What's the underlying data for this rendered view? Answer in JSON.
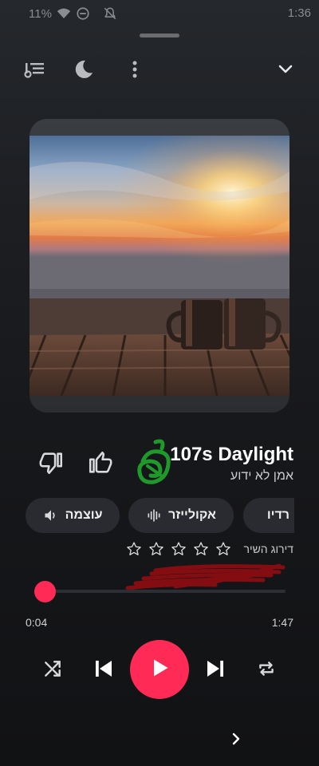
{
  "status_bar": {
    "battery": "11%",
    "time": "1:36",
    "icons": [
      "battery-icon",
      "wifi-icon",
      "do-not-disturb-icon",
      "notifications-off-icon"
    ]
  },
  "toolbar": {
    "icons": [
      "queue-icon",
      "sleep-timer-icon",
      "more-vert-icon",
      "collapse-icon"
    ]
  },
  "track": {
    "title": "107s Daylight",
    "artist": "אמן לא ידוע"
  },
  "chips": {
    "volume_label": "עוצמה",
    "equalizer_label": "אקולייזר",
    "radio_label": "רדיו"
  },
  "rating": {
    "label": "דירוג השיר",
    "stars_total": 5,
    "stars_filled": 0
  },
  "progress": {
    "elapsed": "0:04",
    "duration": "1:47",
    "fraction": 0.04
  },
  "colors": {
    "accent": "#ff2a55",
    "background": "#141518",
    "chip": "#2a2b30"
  }
}
